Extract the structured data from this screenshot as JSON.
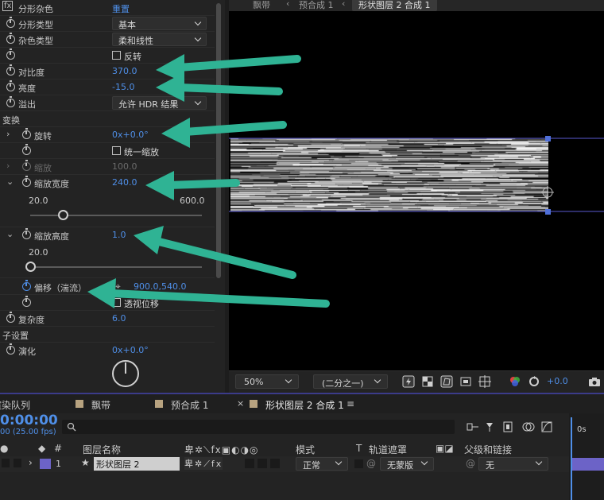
{
  "effect_panel": {
    "header": {
      "label": "分形杂色",
      "reset": "重置"
    },
    "rows": {
      "fractal_type": {
        "label": "分形类型",
        "value": "基本"
      },
      "noise_type": {
        "label": "杂色类型",
        "value": "柔和线性"
      },
      "invert": {
        "label": "反转"
      },
      "contrast": {
        "label": "对比度",
        "value": "370.0"
      },
      "brightness": {
        "label": "亮度",
        "value": "-15.0"
      },
      "overflow": {
        "label": "溢出",
        "value": "允许 HDR 结果"
      },
      "transform": {
        "label": "变换"
      },
      "rotation": {
        "label": "旋转",
        "value": "0x+0.0°"
      },
      "uniform_scale": {
        "label": "统一缩放"
      },
      "scale": {
        "label": "缩放",
        "value": "100.0"
      },
      "scale_width": {
        "label": "缩放宽度",
        "value": "240.0",
        "min": "20.0",
        "max": "600.0",
        "fraction": 0.19
      },
      "scale_height": {
        "label": "缩放高度",
        "value": "1.0",
        "min": "20.0",
        "fraction": 0.0
      },
      "offset": {
        "label": "偏移（湍流）",
        "value": "900.0,540.0"
      },
      "perspective_offset": {
        "label": "透视位移"
      },
      "complexity": {
        "label": "复杂度",
        "value": "6.0"
      },
      "sub_settings": {
        "label": "子设置"
      },
      "evolution": {
        "label": "演化",
        "value": "0x+0.0°"
      }
    }
  },
  "viewer": {
    "breadcrumbs": [
      "飘带",
      "预合成 1",
      "形状图层 2 合成 1"
    ],
    "zoom": "50%",
    "resolution": "(二分之一)",
    "exposure": "+0.0"
  },
  "timeline": {
    "tabs": [
      {
        "label": "渲染队列"
      },
      {
        "label": "飘带"
      },
      {
        "label": "预合成 1"
      },
      {
        "label": "形状图层 2 合成 1"
      }
    ],
    "timecode": "0:00:00",
    "fps": "00 (25.00 fps)",
    "columns": {
      "num": "#",
      "layer_name": "图层名称",
      "mode": "模式",
      "t": "T",
      "track_matte": "轨道遮罩",
      "parent": "父级和链接"
    },
    "ruler_label": "0s",
    "layer": {
      "index": "1",
      "name": "形状图层 2",
      "mode": "正常",
      "matte": "无蒙版",
      "parent": "无"
    }
  },
  "colors": {
    "accent": "#4f8fe8",
    "arrow": "#2fb394",
    "layer_bar": "#6c63c7",
    "tab_swatch": "#b8a380"
  }
}
